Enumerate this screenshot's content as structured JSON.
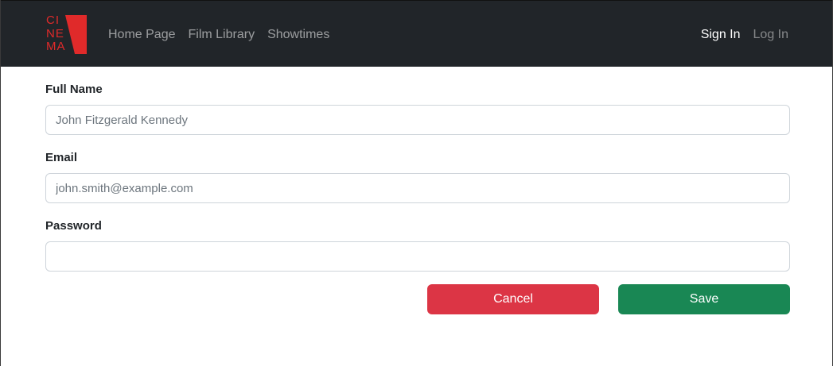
{
  "brand": {
    "logo_text": "CI NE MA",
    "logo_color": "#e02a2a"
  },
  "nav": {
    "links": [
      "Home Page",
      "Film Library",
      "Showtimes"
    ],
    "sign_in": "Sign In",
    "log_in": "Log In"
  },
  "form": {
    "full_name_label": "Full Name",
    "full_name_placeholder": "John Fitzgerald Kennedy",
    "email_label": "Email",
    "email_placeholder": "john.smith@example.com",
    "password_label": "Password",
    "password_placeholder": "",
    "cancel_label": "Cancel",
    "save_label": "Save"
  },
  "colors": {
    "navbar_bg": "#212529",
    "cancel": "#dc3545",
    "save": "#198754"
  }
}
